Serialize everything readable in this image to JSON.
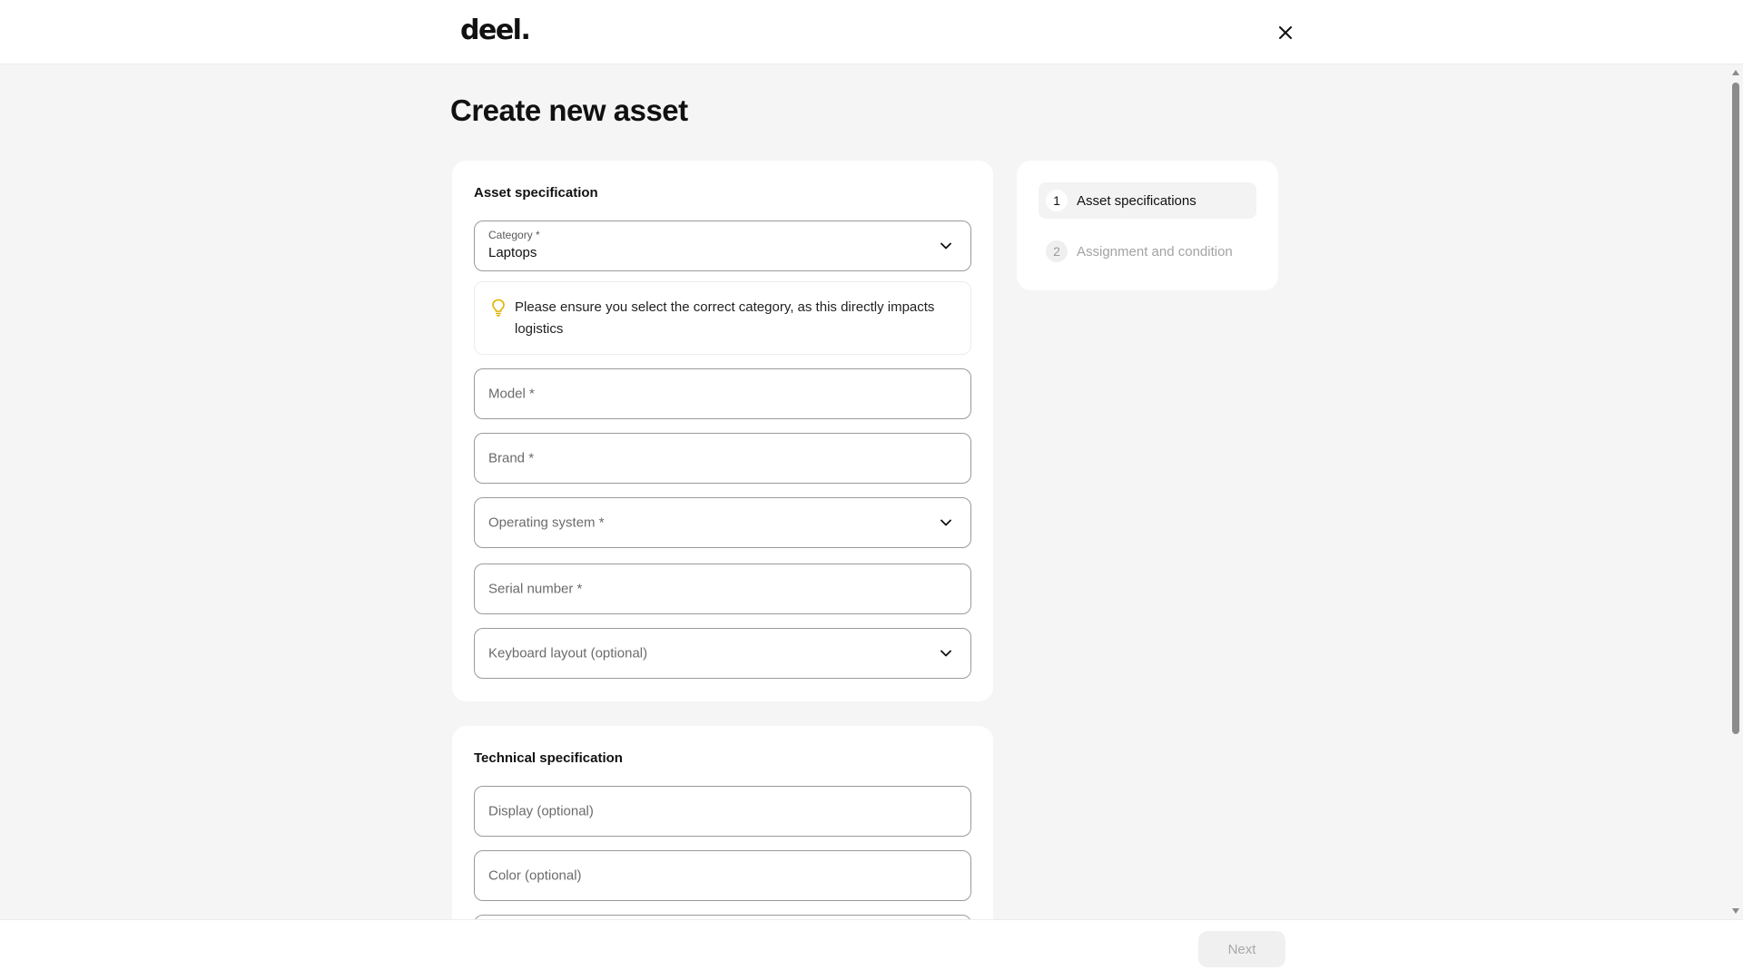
{
  "header": {
    "logo_text": "deel.",
    "close_icon": "close-icon"
  },
  "page": {
    "title": "Create new asset"
  },
  "asset_spec": {
    "heading": "Asset specification",
    "category": {
      "label": "Category *",
      "value": "Laptops"
    },
    "tip_icon": "lightbulb-icon",
    "tip_color": "#e2b200",
    "tip_text": "Please ensure you select the correct category, as this directly impacts logistics",
    "model_placeholder": "Model *",
    "brand_placeholder": "Brand *",
    "os_placeholder": "Operating system *",
    "serial_placeholder": "Serial number *",
    "keyboard_placeholder": "Keyboard layout (optional)"
  },
  "tech_spec": {
    "heading": "Technical specification",
    "display_placeholder": "Display (optional)",
    "color_placeholder": "Color (optional)"
  },
  "steps": [
    {
      "num": "1",
      "label": "Asset specifications",
      "state": "active"
    },
    {
      "num": "2",
      "label": "Assignment and condition",
      "state": "inactive"
    }
  ],
  "footer": {
    "next_label": "Next",
    "next_disabled": true
  }
}
